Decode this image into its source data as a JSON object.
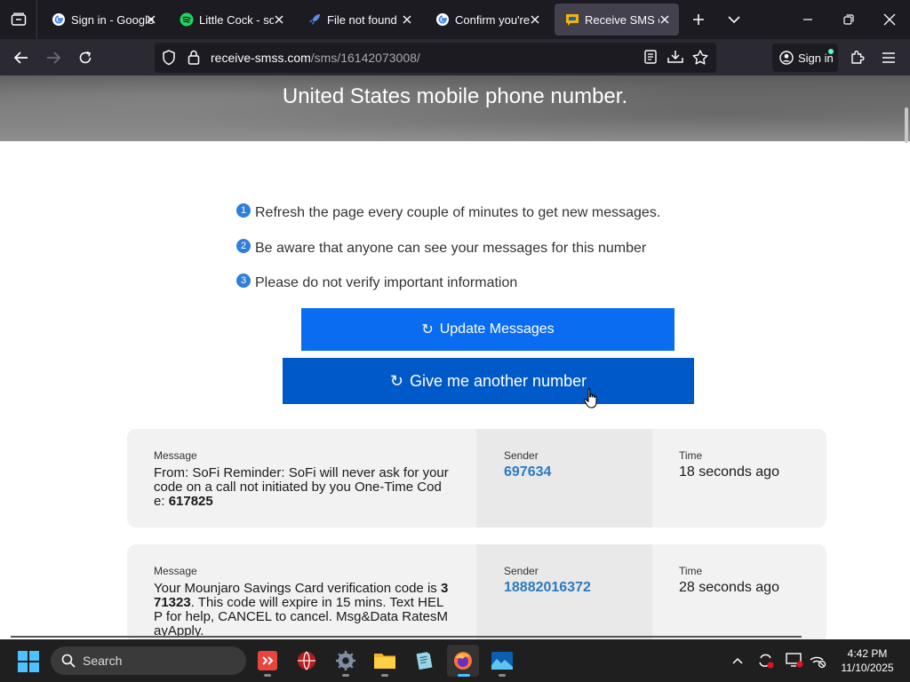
{
  "browser": {
    "tabs": [
      {
        "label": "Sign in - Google Accounts",
        "icon": "google-icon",
        "active": false
      },
      {
        "label": "Little Cock - song and lyrics",
        "icon": "spotify-icon",
        "active": false
      },
      {
        "label": "File not found",
        "icon": "rocket-icon",
        "active": false
      },
      {
        "label": "Confirm you're not a robot",
        "icon": "google-icon",
        "active": false
      },
      {
        "label": "Receive SMS online",
        "icon": "sms-site-icon",
        "active": true
      }
    ],
    "url": {
      "domain": "receive-smss.com",
      "path": "/sms/16142073008/"
    },
    "sign_in_label": "Sign in"
  },
  "page": {
    "hero_title": "United States mobile phone number.",
    "tips": [
      {
        "num": "1",
        "text": "Refresh the page every couple of minutes to get new messages."
      },
      {
        "num": "2",
        "text": "Be aware that anyone can see your messages for this number"
      },
      {
        "num": "3",
        "text": "Please do not verify important information"
      }
    ],
    "update_button": "Update Messages",
    "another_button": "Give me another number",
    "columns": {
      "message": "Message",
      "sender": "Sender",
      "time": "Time"
    },
    "messages": [
      {
        "text_before": "From: SoFi Reminder: SoFi will never ask for your code on a call not initiated by you One-Time Code: ",
        "code": "617825",
        "text_after": "",
        "sender": "697634",
        "time": "18 seconds ago"
      },
      {
        "text_before": "Your Mounjaro Savings Card verification code is ",
        "code": "371323",
        "text_after": ". This code will expire in 15 mins. Text HELP for help, CANCEL to cancel. Msg&Data RatesMayApply.",
        "sender": "18882016372",
        "time": "28 seconds ago"
      }
    ]
  },
  "taskbar": {
    "search_placeholder": "Search",
    "time": "4:42 PM",
    "date": "11/10/2025"
  },
  "colors": {
    "accent_blue": "#0a6cf0",
    "dark_blue": "#0059c9",
    "sender_link": "#2a7bbf",
    "tip_badge": "#2f7fd9"
  }
}
